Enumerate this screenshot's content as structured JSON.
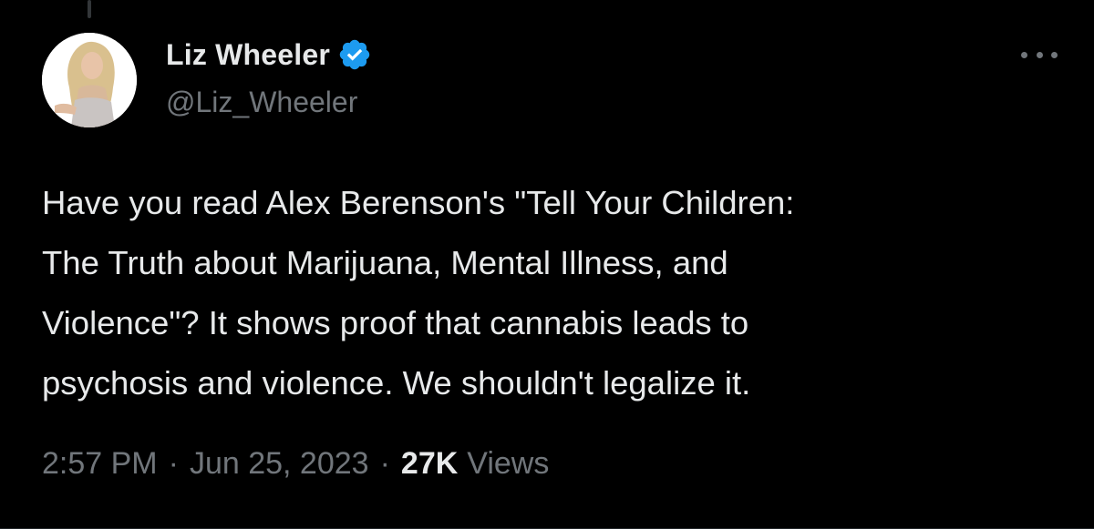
{
  "tweet": {
    "author": {
      "display_name": "Liz Wheeler",
      "handle": "@Liz_Wheeler",
      "verified": true,
      "verified_color": "#1d9bf0"
    },
    "more_icon": "more-horizontal-icon",
    "text": "Have you read Alex Berenson's \"Tell Your Children:\nThe Truth about Marijuana, Mental Illness, and\nViolence\"? It shows proof that cannabis leads to\npsychosis and violence. We shouldn't legalize it.",
    "time": "2:57 PM",
    "separator": "·",
    "date": "Jun 25, 2023",
    "views_count": "27K",
    "views_label": "Views"
  },
  "colors": {
    "background": "#000000",
    "primary_text": "#e7e9ea",
    "secondary_text": "#71767b",
    "accent": "#1d9bf0"
  }
}
